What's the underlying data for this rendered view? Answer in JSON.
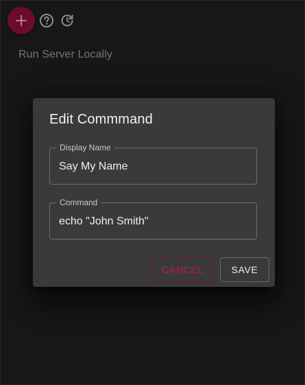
{
  "toolbar": {
    "add_icon": "plus-icon",
    "help_icon": "help-circle-icon",
    "refresh_icon": "refresh-icon"
  },
  "commands": [
    {
      "label": "Run Server Locally"
    }
  ],
  "dialog": {
    "title": "Edit Commmand",
    "display_name": {
      "label": "Display Name",
      "value": "Say My Name"
    },
    "command": {
      "label": "Command",
      "value": "echo \"John Smith\""
    },
    "cancel_label": "CANCEL",
    "save_label": "SAVE"
  },
  "colors": {
    "accent": "#7f0f36",
    "cancel_text": "#c2184f",
    "background": "#1c1c1c",
    "dialog_bg": "#3a3a3a"
  }
}
